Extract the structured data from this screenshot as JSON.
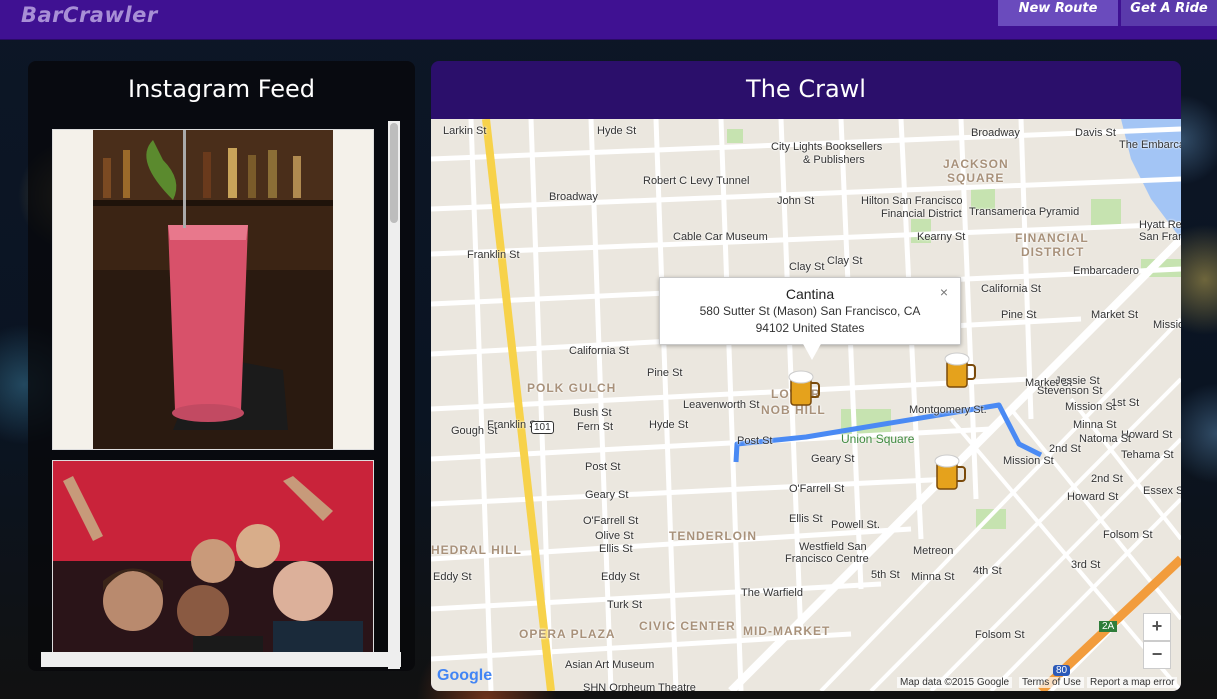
{
  "header": {
    "brand": "BarCrawler",
    "nav": [
      {
        "label": "New Route"
      },
      {
        "label": "Get A Ride"
      }
    ],
    "color_bg": "#3f1192"
  },
  "instagram": {
    "title": "Instagram Feed"
  },
  "crawl": {
    "title": "The Crawl",
    "info_window": {
      "title": "Cantina",
      "address_line1": "580 Sutter St (Mason) San Francisco, CA",
      "address_line2": "94102 United States",
      "close": "×"
    },
    "zoom_in": "+",
    "zoom_out": "−",
    "google": "Google",
    "footer": {
      "map_data": "Map data ©2015 Google",
      "terms": "Terms of Use",
      "report": "Report a map error"
    },
    "route_color": "#4a8af4",
    "labels": {
      "polk_gulch": "POLK GULCH",
      "lower_nob_hill_1": "LOWER",
      "lower_nob_hill_2": "NOB HILL",
      "tenderloin": "TENDERLOIN",
      "civic_center": "CIVIC CENTER",
      "mid_market": "MID-MARKET",
      "opera_plaza": "OPERA PLAZA",
      "cathedral_hill": "HEDRAL HILL",
      "jackson_square_1": "JACKSON",
      "jackson_square_2": "SQUARE",
      "financial_1": "FINANCIAL",
      "financial_2": "DISTRICT",
      "union_square": "Union Square",
      "city_lights_1": "City Lights Booksellers",
      "city_lights_2": "& Publishers",
      "hilton_1": "Hilton San Francisco",
      "hilton_2": "Financial District",
      "transamerica": "Transamerica Pyramid",
      "hyatt_1": "Hyatt Rege",
      "hyatt_2": "San Francis",
      "cable_car": "Cable Car Museum",
      "embarcadero": "Embarcadero",
      "montgomery": "Montgomery St.",
      "powell": "Powell St.",
      "westfield_1": "Westfield San",
      "westfield_2": "Francisco Centre",
      "metreon": "Metreon",
      "warfield": "The Warfield",
      "asian_art": "Asian Art Museum",
      "shn": "SHN Orpheum Theatre",
      "broadway_1": "Broadway",
      "broadway_2": "Broadway",
      "robert_levy": "Robert C Levy Tunnel",
      "john_st": "John St",
      "clay_st": "Clay St",
      "clay_st2": "Clay St",
      "california_st": "California St",
      "california_st2": "California St",
      "pine_st": "Pine St",
      "pine_st2": "Pine St",
      "bush_st": "Bush St",
      "fern_st": "Fern St",
      "post_st": "Post St",
      "post_st2": "Post St",
      "geary_st": "Geary St",
      "geary_st2": "Geary St",
      "ofarrell": "O'Farrell St",
      "ofarrell2": "O'Farrell St",
      "olive_st": "Olive St",
      "ellis_st": "Ellis St",
      "ellis_st2": "Ellis St",
      "eddy_st": "Eddy St",
      "eddy_st2": "Eddy St",
      "turk_st": "Turk St",
      "franklin_st": "Franklin St",
      "franklin_st2": "Franklin St",
      "gough_st": "Gough St",
      "hyde_st": "Hyde St",
      "hyde_st2": "Hyde St",
      "leavenworth": "Leavenworth St",
      "market_st": "Market St",
      "market_st2": "Market St",
      "mission_st": "Mission St",
      "mission_st2": "Mission St",
      "mission_st3": "Mission St",
      "howard_st": "Howard St",
      "howard_st2": "Howard St",
      "folsom_st": "Folsom St",
      "folsom_st2": "Folsom St",
      "2nd_st": "2nd St",
      "2nd_st2": "2nd St",
      "3rd_st": "3rd St",
      "4th_st": "4th St",
      "5th_st": "5th St",
      "1st_st": "1st St",
      "minna_st": "Minna St",
      "minna_st2": "Minna St",
      "natoma": "Natoma St",
      "jessie": "Jessie St",
      "stevenson": "Stevenson St",
      "tehama": "Tehama St",
      "essex": "Essex St",
      "the_embarcadero": "The Embarcadero",
      "davis_st": "Davis St",
      "kearny_st": "Kearny St",
      "larkin_st": "Larkin St",
      "us101": "101",
      "i80": "80",
      "exit_2a": "2A"
    }
  }
}
